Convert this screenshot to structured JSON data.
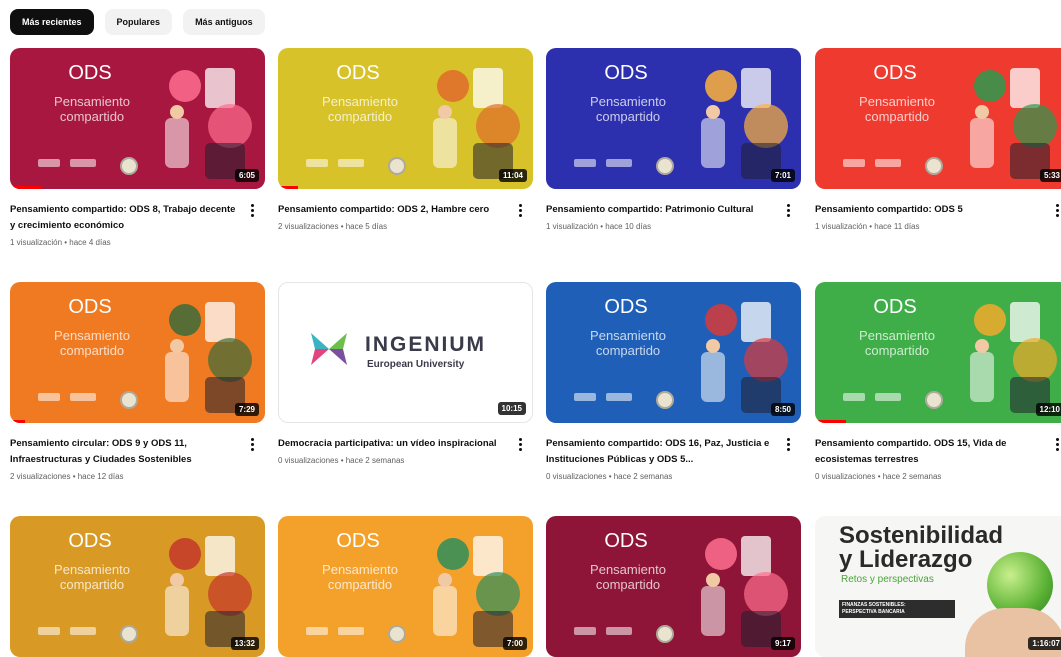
{
  "filters": [
    "Más recientes",
    "Populares",
    "Más antiguos"
  ],
  "videos": [
    {
      "title": "Pensamiento compartido: ODS 8, Trabajo decente y crecimiento económico",
      "meta": "1 visualización • hace 4 días",
      "duration": "6:05",
      "progress": 0.12,
      "thumb": {
        "bg": "#a8173f",
        "ods": "ODS",
        "sub": "Pensamiento compartido",
        "accent": "#ff6e8f"
      }
    },
    {
      "title": "Pensamiento compartido: ODS 2, Hambre cero",
      "meta": "2 visualizaciones • hace 5 días",
      "duration": "11:04",
      "progress": 0.08,
      "thumb": {
        "bg": "#d8c229",
        "ods": "ODS",
        "sub": "Pensamiento compartido",
        "accent": "#e06b2a"
      }
    },
    {
      "title": "Pensamiento compartido: Patrimonio Cultural",
      "meta": "1 visualización • hace 10 días",
      "duration": "7:01",
      "progress": 0,
      "thumb": {
        "bg": "#2c2fae",
        "ods": "ODS",
        "sub": "Pensamiento compartido",
        "accent": "#ffb23a"
      }
    },
    {
      "title": "Pensamiento compartido: ODS 5",
      "meta": "1 visualización • hace 11 días",
      "duration": "5:33",
      "progress": 0,
      "thumb": {
        "bg": "#ee3a2f",
        "ods": "ODS",
        "sub": "Pensamiento compartido",
        "accent": "#2b9a4e"
      }
    },
    {
      "title": "Pensamiento circular: ODS 9 y ODS 11, Infraestructuras y Ciudades Sostenibles",
      "meta": "2 visualizaciones • hace 12 días",
      "duration": "7:29",
      "progress": 0.06,
      "thumb": {
        "bg": "#f07a21",
        "ods": "ODS",
        "sub": "Pensamiento compartido",
        "accent": "#3c6b3a"
      }
    },
    {
      "title": "Democracia participativa: un vídeo inspiracional",
      "meta": "0 visualizaciones • hace 2 semanas",
      "duration": "10:15",
      "progress": 0,
      "thumb": {
        "bg": "#ffffff",
        "brand": "INGENIUM",
        "brand_sub": "European University"
      }
    },
    {
      "title": "Pensamiento compartido: ODS 16, Paz, Justicia e Instituciones Públicas y ODS 5...",
      "meta": "0 visualizaciones • hace 2 semanas",
      "duration": "8:50",
      "progress": 0,
      "thumb": {
        "bg": "#1f5fb7",
        "ods": "ODS",
        "sub": "Pensamiento compartido",
        "accent": "#d83a3a"
      }
    },
    {
      "title": "Pensamiento compartido. ODS 15, Vida de ecosistemas terrestres",
      "meta": "0 visualizaciones • hace 2 semanas",
      "duration": "12:10",
      "progress": 0.12,
      "thumb": {
        "bg": "#3fae49",
        "ods": "ODS",
        "sub": "Pensamiento compartido",
        "accent": "#f2a92b"
      }
    },
    {
      "title": "",
      "meta": "",
      "duration": "13:32",
      "progress": 0,
      "thumb": {
        "bg": "#d99a25",
        "ods": "ODS",
        "sub": "Pensamiento compartido",
        "accent": "#c3362a"
      }
    },
    {
      "title": "",
      "meta": "",
      "duration": "7:00",
      "progress": 0,
      "thumb": {
        "bg": "#f4a12c",
        "ods": "ODS",
        "sub": "Pensamiento compartido",
        "accent": "#2e8e5c"
      }
    },
    {
      "title": "",
      "meta": "",
      "duration": "9:17",
      "progress": 0,
      "thumb": {
        "bg": "#8e1538",
        "ods": "ODS",
        "sub": "Pensamiento compartido",
        "accent": "#ff6e8f"
      }
    },
    {
      "title": "",
      "meta": "",
      "duration": "1:16:07",
      "progress": 0,
      "thumb": {
        "bg": "#f6f6f4",
        "headline1": "Sostenibilidad",
        "headline2": "y Liderazgo",
        "tagline": "Retos y perspectivas",
        "box1": "FINANZAS SOSTENIBLES:",
        "box2": "PERSPECTIVA BANCARIA"
      }
    }
  ]
}
